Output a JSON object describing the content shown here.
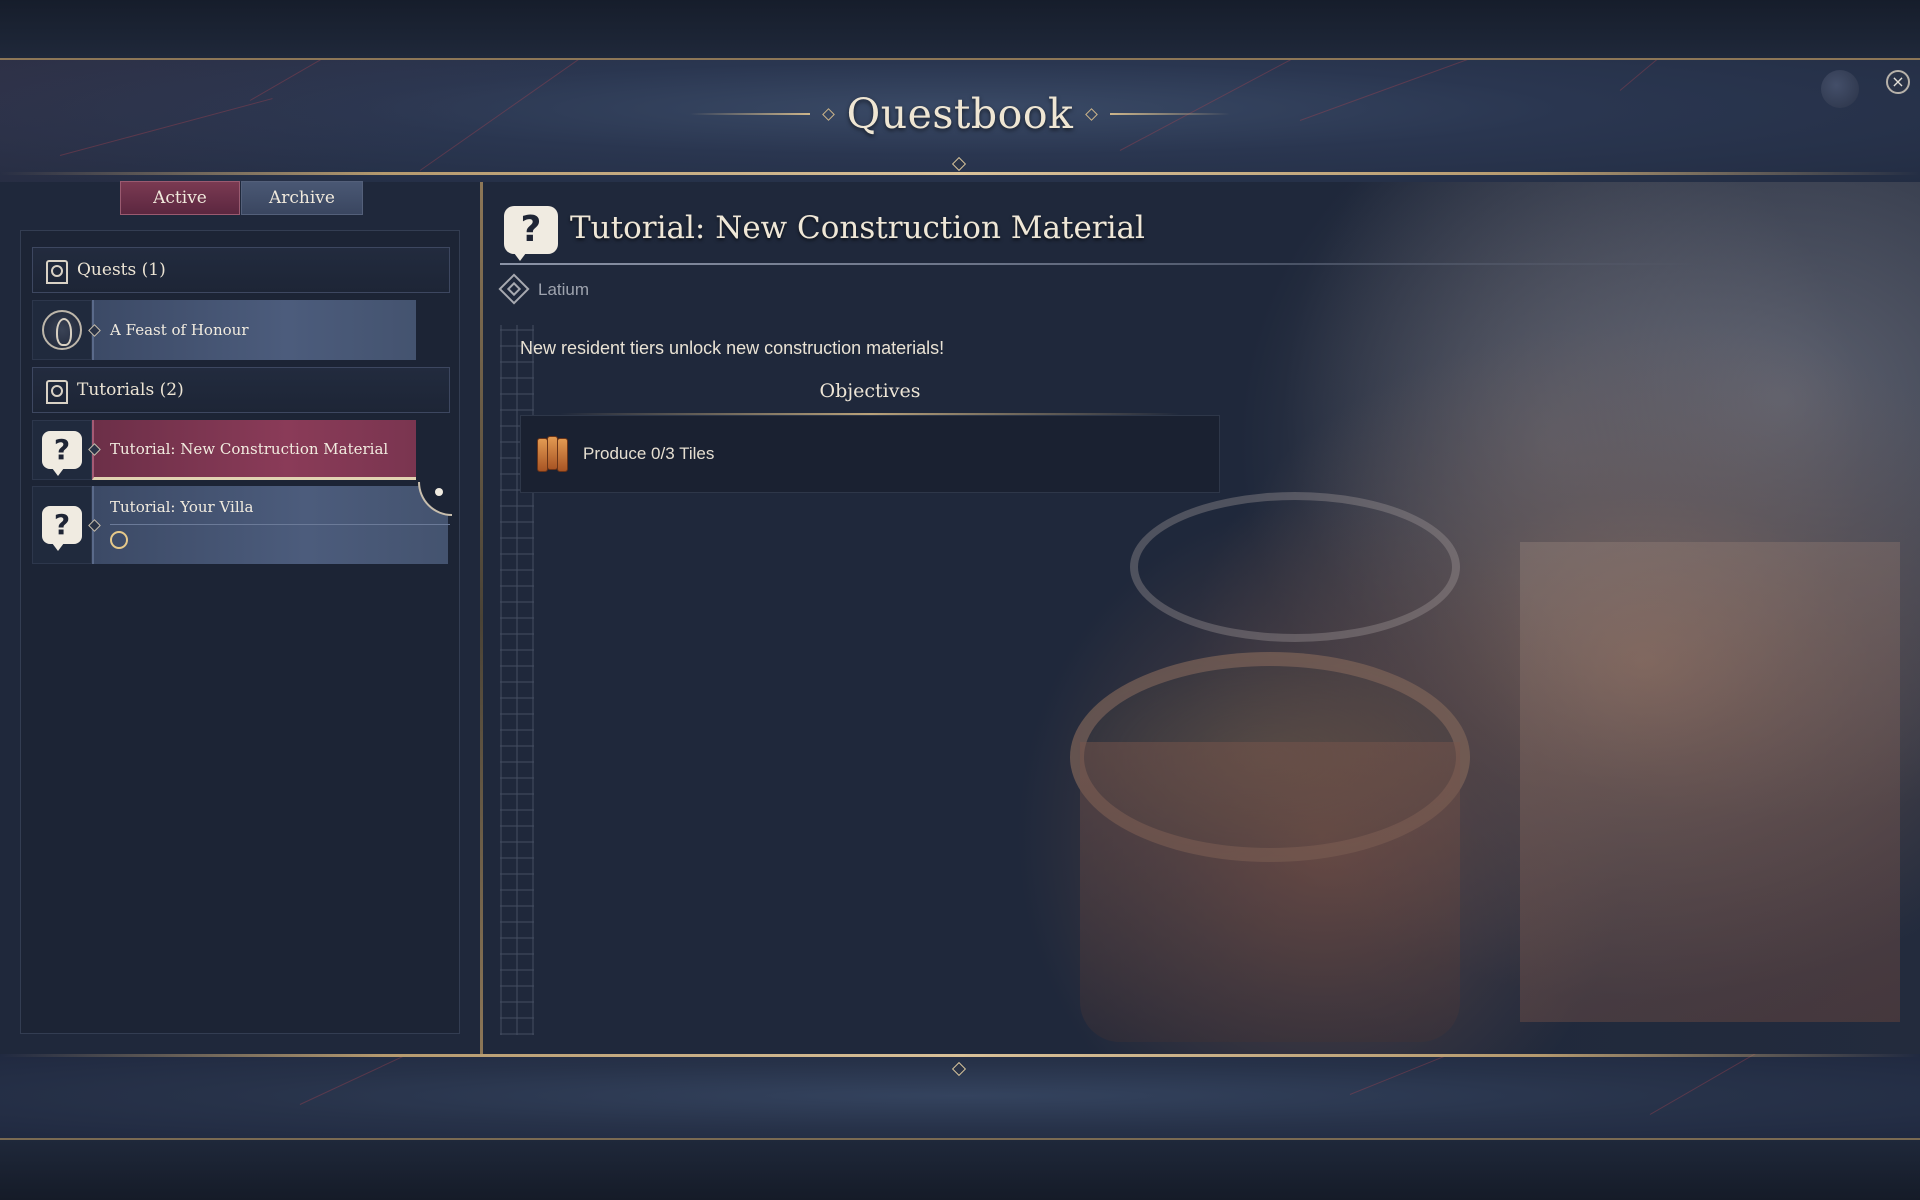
{
  "window": {
    "title": "Questbook",
    "close_icon": "close-icon",
    "close_glyph": "×"
  },
  "tabs": [
    {
      "label": "Active",
      "selected": true
    },
    {
      "label": "Archive",
      "selected": false
    }
  ],
  "categories": [
    {
      "label": "Quests (1)",
      "icon": "quest-category-icon",
      "items": [
        {
          "label": "A Feast of Honour",
          "icon": "portrait-coin-icon",
          "selected": false
        }
      ]
    },
    {
      "label": "Tutorials (2)",
      "icon": "tutorial-category-icon",
      "items": [
        {
          "label": "Tutorial: New Construction Material",
          "icon": "question-bubble-icon",
          "selected": true,
          "glyph": "?"
        },
        {
          "label": "Tutorial: Your Villa",
          "icon": "question-bubble-icon",
          "selected": false,
          "glyph": "?",
          "sub_icon": "resident-download-icon",
          "pinned": true
        }
      ]
    }
  ],
  "detail": {
    "icon": "question-bubble-icon",
    "icon_glyph": "?",
    "title": "Tutorial: New Construction Material",
    "region_icon": "region-diamond-icon",
    "region": "Latium",
    "description": "New resident tiers unlock new construction materials!",
    "objectives_title": "Objectives",
    "objectives": [
      {
        "icon": "roof-tiles-icon",
        "text": "Produce 0/3 Tiles"
      }
    ]
  },
  "colors": {
    "accent_red": "#7a3550",
    "accent_blue": "#44536f",
    "gold": "#b59a6f",
    "background": "#1f283b"
  }
}
